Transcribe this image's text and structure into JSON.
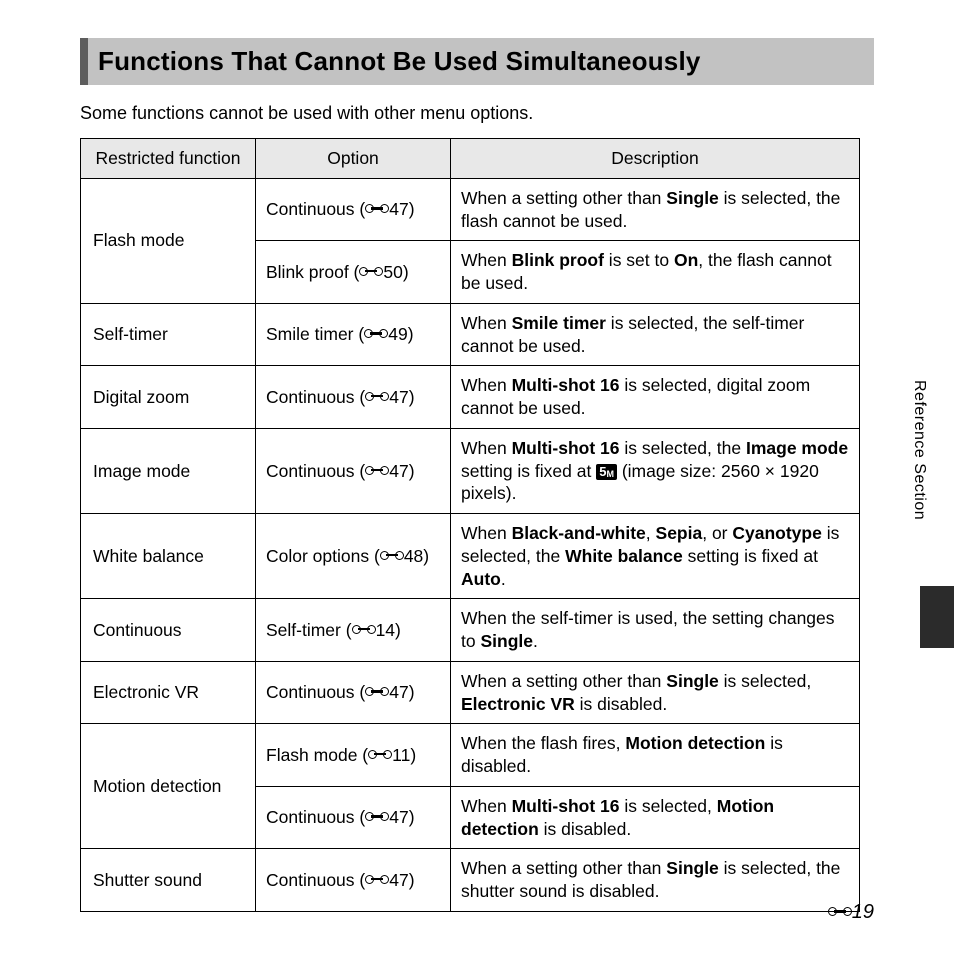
{
  "title": "Functions That Cannot Be Used Simultaneously",
  "intro": "Some functions cannot be used with other menu options.",
  "headers": {
    "c1": "Restricted function",
    "c2": "Option",
    "c3": "Description"
  },
  "side_label": "Reference Section",
  "page_number": "19",
  "rows": {
    "r0_func": "Flash mode",
    "r0_opt": "Continuous",
    "r0_ref": "47",
    "r0_desc_a": "When a setting other than ",
    "r0_bold_1": "Single",
    "r0_desc_b": " is selected, the flash cannot be used.",
    "r1_opt": "Blink proof",
    "r1_ref": "50",
    "r1_desc_a": "When ",
    "r1_bold_1": "Blink proof",
    "r1_desc_b": " is set to ",
    "r1_bold_2": "On",
    "r1_desc_c": ", the flash cannot be used.",
    "r2_func": "Self-timer",
    "r2_opt": "Smile timer",
    "r2_ref": "49",
    "r2_desc_a": "When ",
    "r2_bold_1": "Smile timer",
    "r2_desc_b": " is selected, the self-timer cannot be used.",
    "r3_func": "Digital zoom",
    "r3_opt": "Continuous",
    "r3_ref": "47",
    "r3_desc_a": "When ",
    "r3_bold_1": "Multi-shot 16",
    "r3_desc_b": " is selected, digital zoom cannot be used.",
    "r4_func": "Image mode",
    "r4_opt": "Continuous",
    "r4_ref": "47",
    "r4_desc_a": "When ",
    "r4_bold_1": "Multi-shot 16",
    "r4_desc_b": " is selected, the ",
    "r4_bold_2": "Image mode",
    "r4_desc_c": " setting is fixed at ",
    "r4_desc_d": " (image size: 2560 × 1920 pixels).",
    "r5_func": "White balance",
    "r5_opt": "Color options",
    "r5_ref": "48",
    "r5_desc_a": "When ",
    "r5_bold_1": "Black-and-white",
    "r5_desc_b": ", ",
    "r5_bold_2": "Sepia",
    "r5_desc_c": ", or ",
    "r5_bold_3": "Cyanotype",
    "r5_desc_d": " is selected, the ",
    "r5_bold_4": "White balance",
    "r5_desc_e": " setting is fixed at ",
    "r5_bold_5": "Auto",
    "r5_desc_f": ".",
    "r6_func": "Continuous",
    "r6_opt": "Self-timer",
    "r6_ref": "14",
    "r6_desc_a": "When the self-timer is used, the setting changes to ",
    "r6_bold_1": "Single",
    "r6_desc_b": ".",
    "r7_func": "Electronic VR",
    "r7_opt": "Continuous",
    "r7_ref": "47",
    "r7_desc_a": "When a setting other than ",
    "r7_bold_1": "Single",
    "r7_desc_b": " is selected, ",
    "r7_bold_2": "Electronic VR",
    "r7_desc_c": " is disabled.",
    "r8_func": "Motion detection",
    "r8_opt": "Flash mode",
    "r8_ref": "11",
    "r8_desc_a": "When the flash fires, ",
    "r8_bold_1": "Motion detection",
    "r8_desc_b": " is disabled.",
    "r9_opt": "Continuous",
    "r9_ref": "47",
    "r9_desc_a": "When ",
    "r9_bold_1": "Multi-shot 16",
    "r9_desc_b": " is selected, ",
    "r9_bold_2": "Motion detection",
    "r9_desc_c": " is disabled.",
    "r10_func": "Shutter sound",
    "r10_opt": "Continuous",
    "r10_ref": "47",
    "r10_desc_a": "When a setting other than ",
    "r10_bold_1": "Single",
    "r10_desc_b": " is selected, the shutter sound is disabled."
  }
}
